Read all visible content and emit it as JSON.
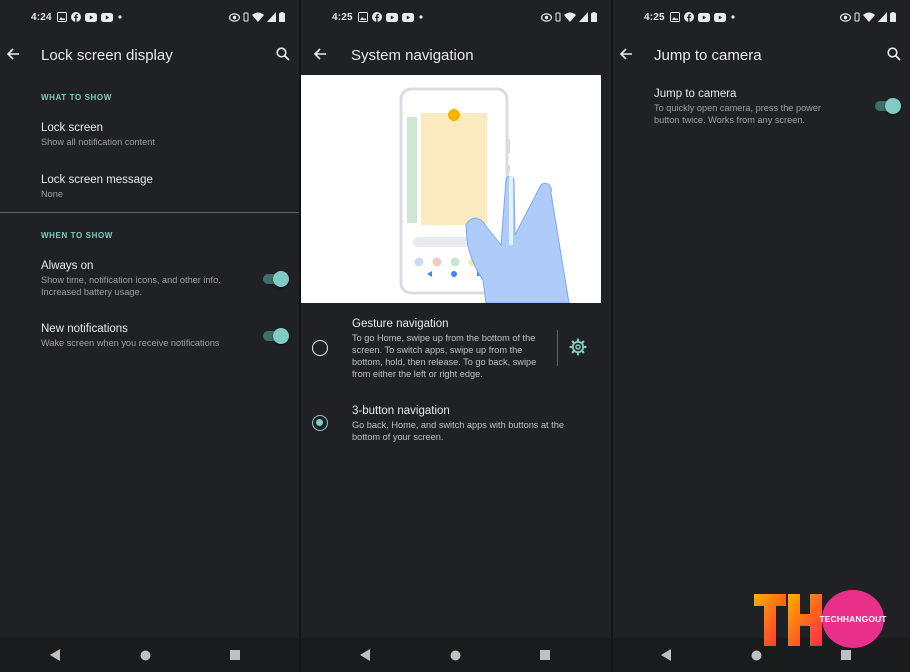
{
  "colors": {
    "background": "#202124",
    "accent": "#80cbc4",
    "text_primary": "#e8eaed",
    "text_secondary": "#9aa0a6",
    "navbar": "#1a1b1d"
  },
  "panel1": {
    "status": {
      "time": "4:24"
    },
    "appbar": {
      "title": "Lock screen display"
    },
    "what_to_show": {
      "header": "WHAT TO SHOW",
      "lock_screen": {
        "title": "Lock screen",
        "summary": "Show all notification content"
      },
      "lock_screen_message": {
        "title": "Lock screen message",
        "summary": "None"
      }
    },
    "when_to_show": {
      "header": "WHEN TO SHOW",
      "always_on": {
        "title": "Always on",
        "summary": "Show time, notification icons, and other info. Increased battery usage.",
        "enabled": true
      },
      "new_notifications": {
        "title": "New notifications",
        "summary": "Wake screen when you receive notifications",
        "enabled": true
      }
    }
  },
  "panel2": {
    "status": {
      "time": "4:25"
    },
    "appbar": {
      "title": "System navigation"
    },
    "options": [
      {
        "title": "Gesture navigation",
        "summary": "To go Home, swipe up from the bottom of the screen. To switch apps, swipe up from the bottom, hold, then release. To go back, swipe from either the left or right edge.",
        "selected": false,
        "has_settings": true
      },
      {
        "title": "3-button navigation",
        "summary": "Go back, Home, and switch apps with buttons at the bottom of your screen.",
        "selected": true
      }
    ]
  },
  "panel3": {
    "status": {
      "time": "4:25"
    },
    "appbar": {
      "title": "Jump to camera"
    },
    "jump_to_camera": {
      "title": "Jump to camera",
      "summary": "To quickly open camera, press the power button twice. Works from any screen.",
      "enabled": true
    }
  },
  "watermark": {
    "logo": "THC",
    "text": "TECHHANGOUT"
  },
  "icons": [
    "back-arrow-icon",
    "search-icon",
    "gear-icon",
    "wifi-icon",
    "battery-icon",
    "facebook-icon",
    "youtube-icon",
    "image-icon",
    "eye-icon"
  ]
}
